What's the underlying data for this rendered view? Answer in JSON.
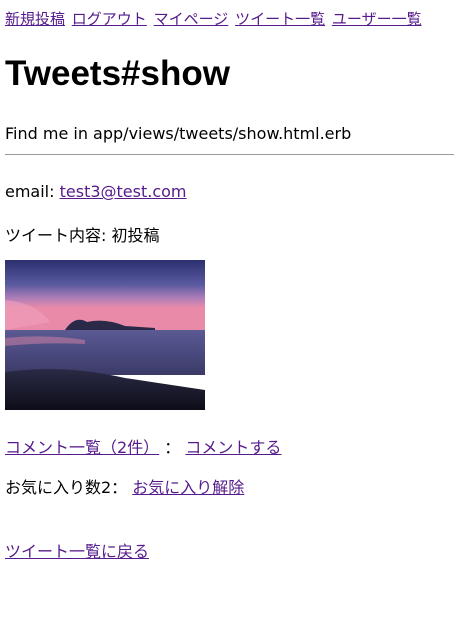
{
  "nav": {
    "new_post": "新規投稿",
    "logout": "ログアウト",
    "mypage": "マイページ",
    "tweet_list": "ツイート一覧",
    "user_list": "ユーザー一覧"
  },
  "page": {
    "title": "Tweets#show",
    "find_text": "Find me in app/views/tweets/show.html.erb"
  },
  "tweet": {
    "email_label": "email:",
    "email": "test3@test.com",
    "content_label": "ツイート内容:",
    "content": "初投稿"
  },
  "comments": {
    "list_link": "コメント一覧（2件）",
    "separator": "：",
    "comment_link": "コメントする"
  },
  "favorite": {
    "label": "お気に入り数2：",
    "unfavorite_link": "お気に入り解除"
  },
  "footer": {
    "back_link": "ツイート一覧に戻る"
  },
  "colors": {
    "link": "#551a8b",
    "text": "#000000",
    "background": "#ffffff"
  }
}
